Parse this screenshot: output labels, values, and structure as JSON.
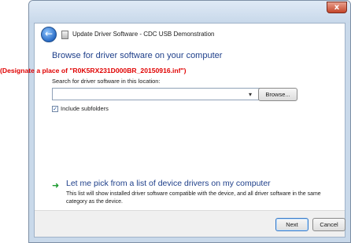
{
  "window": {
    "title": "Update Driver Software - CDC USB Demonstration",
    "close_label": "x"
  },
  "page": {
    "heading": "Browse for driver software on your computer",
    "search_label": "Search for driver software in this location:",
    "path_value": "",
    "browse_label": "Browse...",
    "include_subfolders_label": "Include subfolders",
    "include_subfolders_checked": true,
    "pick_link": "Let me pick from a list of device drivers on my computer",
    "pick_description": "This list will show installed driver software compatible with the device, and all driver software in the same category as the device."
  },
  "footer": {
    "next_label": "Next",
    "cancel_label": "Cancel"
  },
  "annotation": {
    "text": "(Designate a place of \"R0K5RX231D000BR_20150916.inf\")",
    "color": "#e00000"
  },
  "icons": {
    "back": "back-arrow-icon",
    "driver": "driver-icon",
    "dropdown": "chevron-down-icon",
    "check": "checkmark-icon",
    "green_arrow": "green-arrow-icon"
  }
}
